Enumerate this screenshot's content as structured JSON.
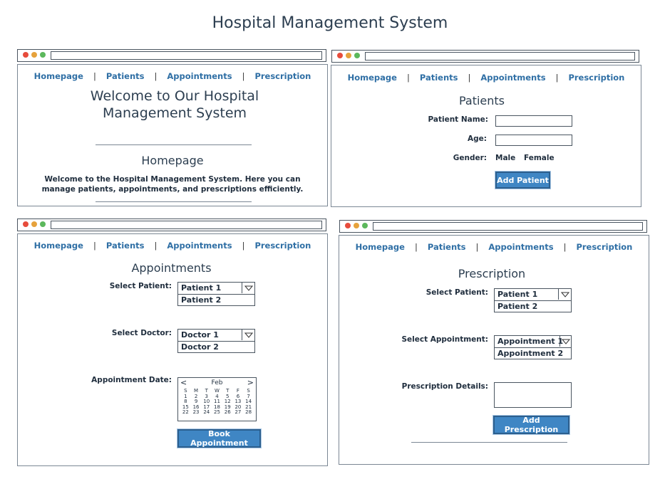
{
  "title": "Hospital Management System",
  "nav": [
    "Homepage",
    "Patients",
    "Appointments",
    "Prescription"
  ],
  "nav_sep": "|",
  "home": {
    "welcome_line1": "Welcome to Our Hospital",
    "welcome_line2": "Management System",
    "heading": "Homepage",
    "desc_line1": "Welcome to the Hospital Management System. Here you can",
    "desc_line2": "manage patients, appointments, and prescriptions efficiently."
  },
  "patients": {
    "heading": "Patients",
    "name_label": "Patient Name:",
    "age_label": "Age:",
    "gender_label": "Gender:",
    "gender_options": [
      "Male",
      "Female"
    ],
    "add_button": "Add Patient"
  },
  "appointments": {
    "heading": "Appointments",
    "patient_label": "Select Patient:",
    "patient_options": [
      "Patient 1",
      "Patient 2"
    ],
    "doctor_label": "Select Doctor:",
    "doctor_options": [
      "Doctor 1",
      "Doctor 2"
    ],
    "date_label": "Appointment Date:",
    "calendar": {
      "month": "Feb",
      "prev": "<",
      "next": ">",
      "weekdays": [
        "S",
        "M",
        "T",
        "W",
        "T",
        "F",
        "S"
      ],
      "days": [
        "1",
        "2",
        "3",
        "4",
        "5",
        "6",
        "7",
        "8",
        "9",
        "10",
        "11",
        "12",
        "13",
        "14",
        "15",
        "16",
        "17",
        "18",
        "19",
        "20",
        "21",
        "22",
        "23",
        "24",
        "25",
        "26",
        "27",
        "28"
      ]
    },
    "book_button": "Book Appointment"
  },
  "prescription": {
    "heading": "Prescription",
    "patient_label": "Select Patient:",
    "patient_options": [
      "Patient 1",
      "Patient 2"
    ],
    "appointment_label": "Select Appointment:",
    "appointment_options": [
      "Appointment 1",
      "Appointment 2"
    ],
    "details_label": "Prescription Details:",
    "add_button": "Add Prescription"
  },
  "colors": {
    "link": "#2f6fa5",
    "button": "#3f86c4",
    "heading": "#2c3e50"
  }
}
